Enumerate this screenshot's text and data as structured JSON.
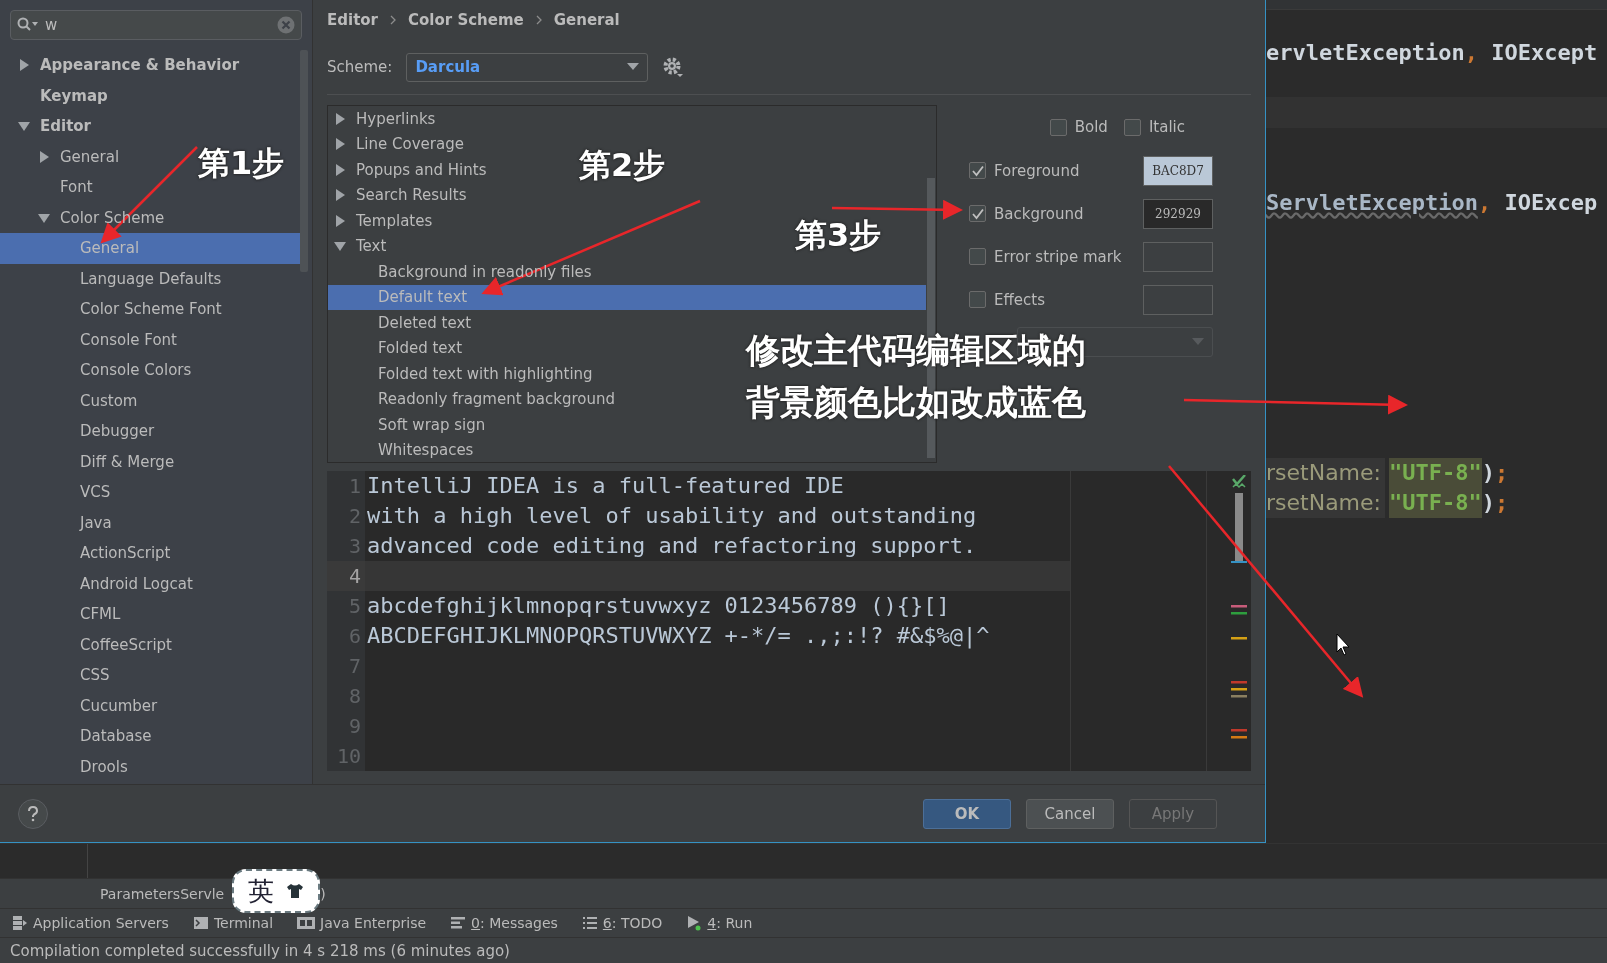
{
  "sidebar": {
    "search": {
      "value": "w"
    },
    "items": [
      {
        "label": "Appearance & Behavior",
        "expanded": false
      },
      {
        "label": "Keymap"
      },
      {
        "label": "Editor",
        "expanded": true,
        "children": [
          {
            "label": "General",
            "expanded": false
          },
          {
            "label": "Font"
          },
          {
            "label": "Color Scheme",
            "expanded": true,
            "children": [
              {
                "label": "General",
                "selected": true
              },
              {
                "label": "Language Defaults",
                "selected": false
              },
              {
                "label": "Color Scheme Font",
                "selected": false
              },
              {
                "label": "Console Font",
                "selected": false
              },
              {
                "label": "Console Colors",
                "selected": false
              },
              {
                "label": "Custom",
                "selected": false
              },
              {
                "label": "Debugger",
                "selected": false
              },
              {
                "label": "Diff & Merge",
                "selected": false
              },
              {
                "label": "VCS",
                "selected": false
              },
              {
                "label": "Java",
                "selected": false
              },
              {
                "label": "ActionScript",
                "selected": false
              },
              {
                "label": "Android Logcat",
                "selected": false
              },
              {
                "label": "CFML",
                "selected": false
              },
              {
                "label": "CoffeeScript",
                "selected": false
              },
              {
                "label": "CSS",
                "selected": false
              },
              {
                "label": "Cucumber",
                "selected": false
              },
              {
                "label": "Database",
                "selected": false
              },
              {
                "label": "Drools",
                "selected": false
              }
            ]
          }
        ]
      }
    ]
  },
  "breadcrumb": [
    "Editor",
    "Color Scheme",
    "General"
  ],
  "scheme": {
    "label": "Scheme:",
    "value": "Darcula"
  },
  "attributes_tree": [
    {
      "label": "Hyperlinks",
      "expanded": false
    },
    {
      "label": "Line Coverage",
      "expanded": false
    },
    {
      "label": "Popups and Hints",
      "expanded": false
    },
    {
      "label": "Search Results",
      "expanded": false
    },
    {
      "label": "Templates",
      "expanded": false
    },
    {
      "label": "Text",
      "expanded": true,
      "children": [
        {
          "label": "Background in readonly files",
          "selected": false
        },
        {
          "label": "Default text",
          "selected": true
        },
        {
          "label": "Deleted text",
          "selected": false
        },
        {
          "label": "Folded text",
          "selected": false
        },
        {
          "label": "Folded text with highlighting",
          "selected": false
        },
        {
          "label": "Readonly fragment background",
          "selected": false
        },
        {
          "label": "Soft wrap sign",
          "selected": false
        },
        {
          "label": "Whitespaces",
          "selected": false
        }
      ]
    }
  ],
  "font_style": [
    {
      "label": "Bold",
      "checked": false
    },
    {
      "label": "Italic",
      "checked": false
    }
  ],
  "colors": [
    {
      "label": "Foreground",
      "checked": true,
      "value": "BAC8D7",
      "color": "#bac8d7"
    },
    {
      "label": "Background",
      "checked": true,
      "value": "292929",
      "color": "#292929"
    },
    {
      "label": "Error stripe mark",
      "checked": false
    },
    {
      "label": "Effects",
      "checked": false
    }
  ],
  "effects_dropdown": {
    "disabled": true
  },
  "preview": {
    "lines": [
      {
        "number": "1",
        "text": "IntelliJ IDEA is a full-featured IDE",
        "current": false
      },
      {
        "number": "2",
        "text": "with a high level of usability and outstanding",
        "current": false
      },
      {
        "number": "3",
        "text": "advanced code editing and refactoring support.",
        "current": false
      },
      {
        "number": "4",
        "current": true
      },
      {
        "number": "5",
        "text": "abcdefghijklmnopqrstuvwxyz 0123456789 (){}[]",
        "current": false
      },
      {
        "number": "6",
        "text": "ABCDEFGHIJKLMNOPQRSTUVWXYZ +-*/= .,;:!? #&$%@|^",
        "current": false
      },
      {
        "number": "7",
        "current": false
      },
      {
        "number": "8",
        "current": false
      },
      {
        "number": "9",
        "current": false
      },
      {
        "number": "10",
        "current": false
      }
    ]
  },
  "buttons": [
    {
      "label": "OK",
      "primary": true,
      "disabled": false
    },
    {
      "label": "Cancel",
      "primary": false,
      "disabled": false
    },
    {
      "label": "Apply",
      "primary": false,
      "disabled": true
    }
  ],
  "background_editor": {
    "lines": [
      {
        "tokens": [
          {
            "kind": "plain",
            "text": "ervletException"
          },
          {
            "kind": "punct",
            "text": ","
          },
          {
            "kind": "plain",
            "text": " IOExcept"
          }
        ]
      },
      {
        "tokens": [
          {
            "kind": "warning",
            "text": "ServletException"
          },
          {
            "kind": "punct",
            "text": ","
          },
          {
            "kind": "plain",
            "text": " IOExcep"
          }
        ]
      },
      {
        "tokens": [
          {
            "kind": "hint",
            "text": "rsetName:"
          },
          {
            "kind": "string",
            "text": "\"UTF-8\""
          },
          {
            "kind": "plain",
            "text": ")"
          },
          {
            "kind": "punct",
            "text": ";"
          }
        ]
      },
      {
        "tokens": [
          {
            "kind": "hint",
            "text": "rsetName:"
          },
          {
            "kind": "string",
            "text": "\"UTF-8\""
          },
          {
            "kind": "plain",
            "text": ")"
          },
          {
            "kind": "punct",
            "text": ";"
          }
        ]
      }
    ]
  },
  "editor_tab": {
    "label": "ParametersServle",
    "tail": ")"
  },
  "ime_badge": {
    "label": "英"
  },
  "tool_windows": [
    {
      "kind": "servers",
      "label": "Application Servers"
    },
    {
      "kind": "terminal",
      "label": "Terminal"
    },
    {
      "kind": "enterprise",
      "label": "Java Enterprise"
    },
    {
      "kind": "messages",
      "mnemonic": "0",
      "label": ": Messages"
    },
    {
      "kind": "todo",
      "mnemonic": "6",
      "label": ": TODO"
    },
    {
      "kind": "run",
      "mnemonic": "4",
      "label": ": Run"
    }
  ],
  "status_bar": "Compilation completed successfully in 4 s 218 ms (6 minutes ago)",
  "annotations": {
    "steps": [
      "第1步",
      "第2步",
      "第3步"
    ],
    "note": [
      "修改主代码编辑区域的",
      "背景颜色比如改成蓝色"
    ]
  }
}
